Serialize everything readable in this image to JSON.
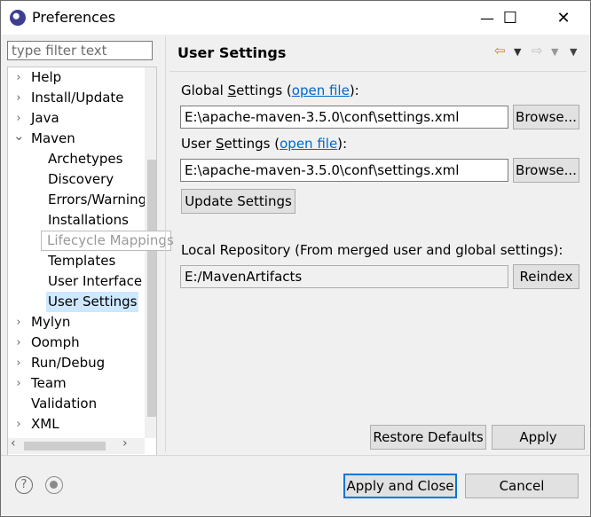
{
  "window": {
    "title": "Preferences",
    "minimize_glyph": "—",
    "maximize_glyph": "☐",
    "close_glyph": "✕"
  },
  "filter": {
    "placeholder": "type filter text"
  },
  "tree": {
    "items": [
      {
        "label": "Help",
        "level": 0,
        "expandable": true,
        "expanded": false
      },
      {
        "label": "Install/Update",
        "level": 0,
        "expandable": true,
        "expanded": false
      },
      {
        "label": "Java",
        "level": 0,
        "expandable": true,
        "expanded": false
      },
      {
        "label": "Maven",
        "level": 0,
        "expandable": true,
        "expanded": true
      },
      {
        "label": "Archetypes",
        "level": 1
      },
      {
        "label": "Discovery",
        "level": 1
      },
      {
        "label": "Errors/Warnings",
        "level": 1
      },
      {
        "label": "Installations",
        "level": 1
      },
      {
        "label": "Lifecycle Mappings",
        "level": 1
      },
      {
        "label": "Templates",
        "level": 1
      },
      {
        "label": "User Interface",
        "level": 1
      },
      {
        "label": "User Settings",
        "level": 1,
        "selected": true
      },
      {
        "label": "Mylyn",
        "level": 0,
        "expandable": true,
        "expanded": false
      },
      {
        "label": "Oomph",
        "level": 0,
        "expandable": true,
        "expanded": false
      },
      {
        "label": "Run/Debug",
        "level": 0,
        "expandable": true,
        "expanded": false
      },
      {
        "label": "Team",
        "level": 0,
        "expandable": true,
        "expanded": false
      },
      {
        "label": "Validation",
        "level": 0,
        "expandable": false
      },
      {
        "label": "XML",
        "level": 0,
        "expandable": true,
        "expanded": false
      }
    ],
    "tooltip": "Lifecycle Mappings"
  },
  "page": {
    "title": "User Settings",
    "global_label_pre": "Global ",
    "global_label_u": "S",
    "global_label_post": "ettings (",
    "global_link": "open file",
    "global_label_end": "):",
    "global_value": "E:\\apache-maven-3.5.0\\conf\\settings.xml",
    "user_label_pre": "User ",
    "user_label_u": "S",
    "user_label_post": "ettings (",
    "user_link": "open file",
    "user_label_end": "):",
    "user_value": "E:\\apache-maven-3.5.0\\conf\\settings.xml",
    "browse_label": "Browse...",
    "update_label": "Update Settings",
    "local_repo_label": "Local Repository (From merged user and global settings):",
    "local_repo_value": "E:/MavenArtifacts",
    "reindex_label": "Reindex",
    "restore_defaults_label": "Restore Defaults",
    "apply_label": "Apply"
  },
  "footer": {
    "apply_close_label": "Apply and Close",
    "cancel_label": "Cancel",
    "help_glyph": "?"
  },
  "colors": {
    "accent": "#0078d7",
    "selection": "#cde8ff",
    "link": "#0066cc"
  }
}
